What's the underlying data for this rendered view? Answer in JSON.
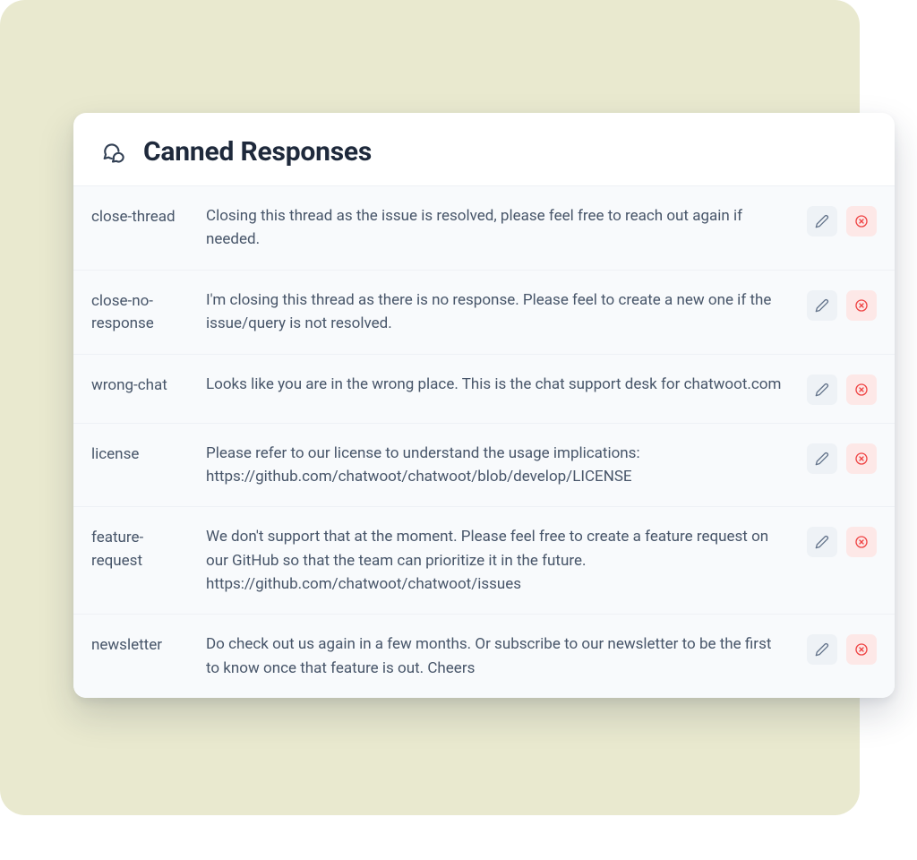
{
  "header": {
    "title": "Canned Responses"
  },
  "responses": [
    {
      "shortcode": "close-thread",
      "content": "Closing this thread as the issue is resolved, please feel free to reach out again if needed."
    },
    {
      "shortcode": "close-no-response",
      "content": "I'm closing this thread as there is no response. Please feel to create a new one if the issue/query is not resolved."
    },
    {
      "shortcode": "wrong-chat",
      "content": "Looks like you are in the wrong place. This is the chat support desk for chatwoot.com"
    },
    {
      "shortcode": "license",
      "content": "Please refer to our license to understand the usage implications: https://github.com/chatwoot/chatwoot/blob/develop/LICENSE"
    },
    {
      "shortcode": "feature-request",
      "content": "We don't support that at the moment. Please feel free to create a feature request on our GitHub so that the team can prioritize it in the future. https://github.com/chatwoot/chatwoot/issues"
    },
    {
      "shortcode": "newsletter",
      "content": "Do check out us again in a few months. Or subscribe to our newsletter to be the first to know once that feature is out. Cheers"
    }
  ]
}
